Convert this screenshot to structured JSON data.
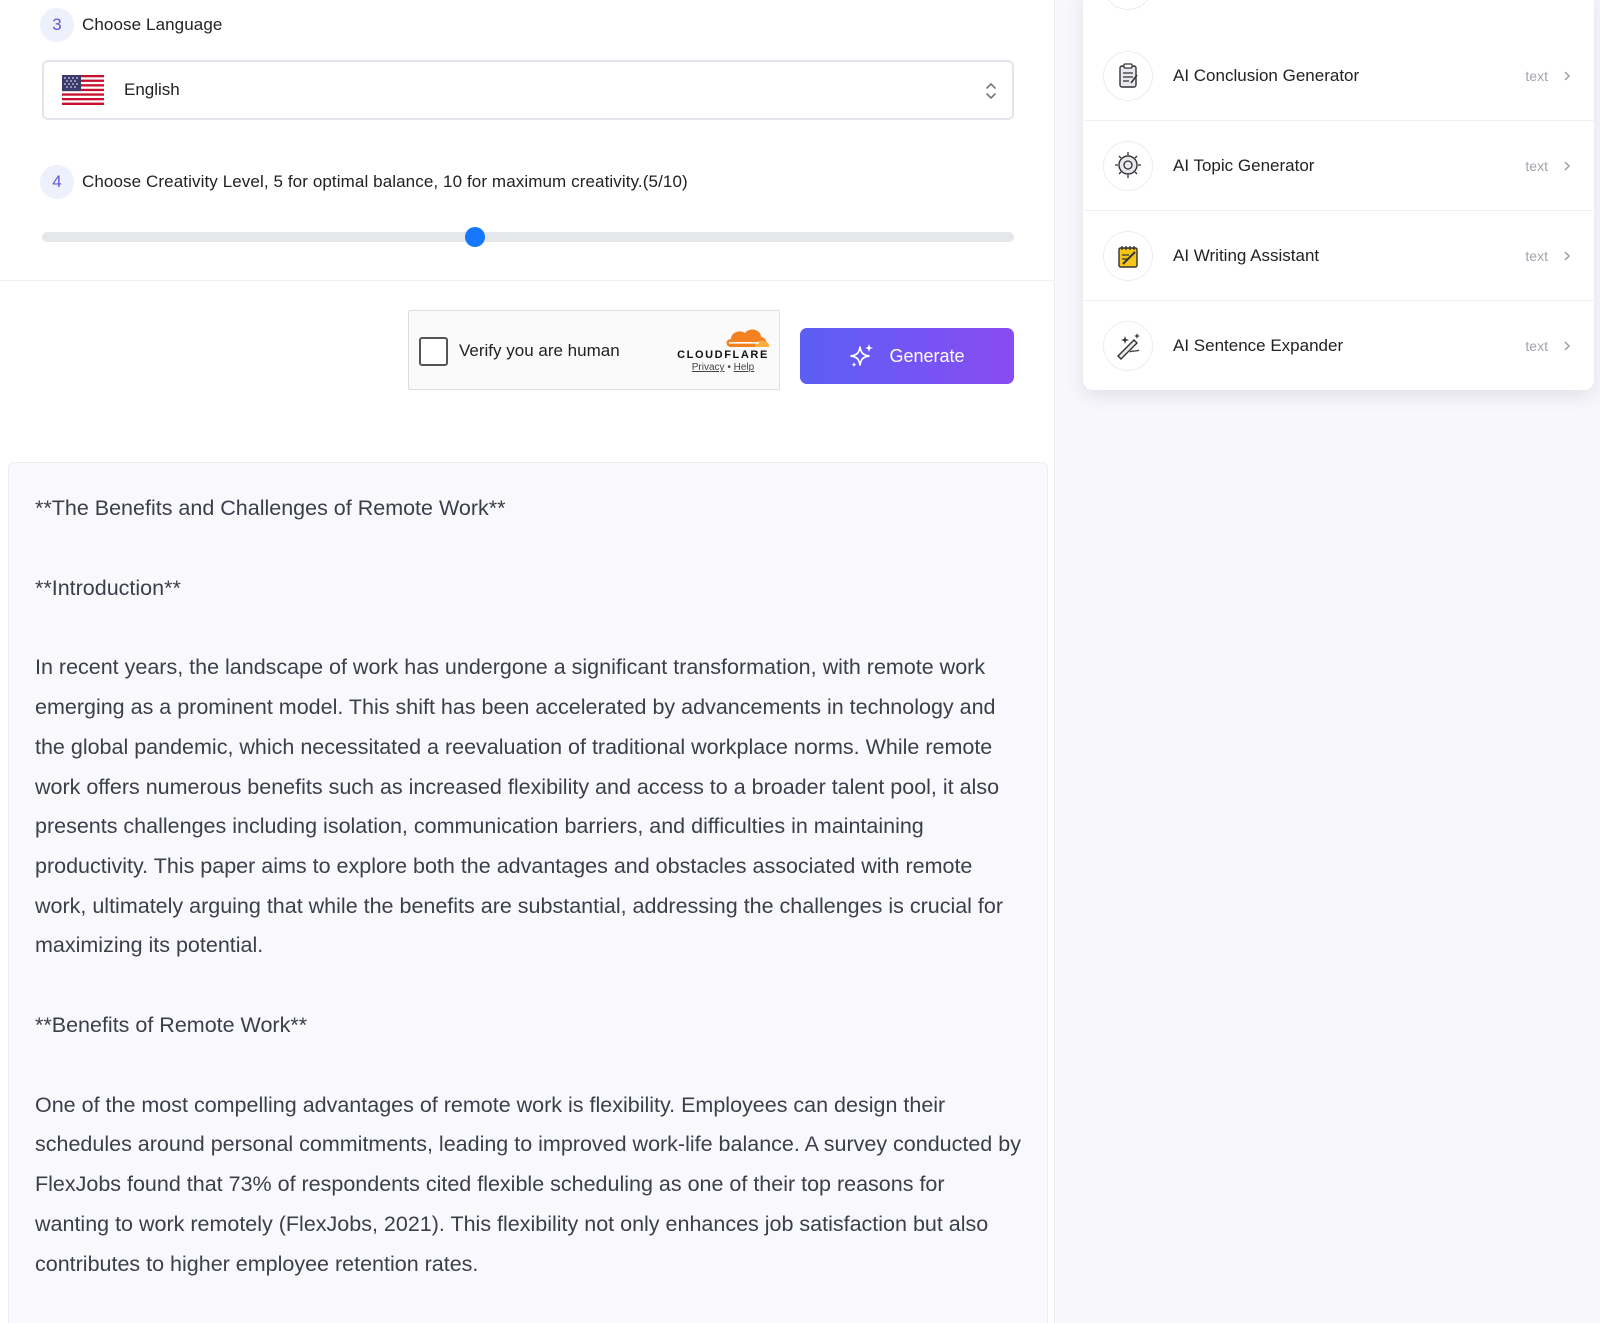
{
  "steps": {
    "language": {
      "number": "3",
      "label": "Choose Language",
      "selected": "English"
    },
    "creativity": {
      "number": "4",
      "label": "Choose Creativity Level, 5 for optimal balance, 10 for maximum creativity.(5/10)",
      "level": 5,
      "max": 10,
      "fill_fraction": 0.445
    }
  },
  "captcha": {
    "label": "Verify you are human",
    "brand": "CLOUDFLARE",
    "privacy": "Privacy",
    "separator": "•",
    "help": "Help"
  },
  "generate_button": {
    "label": "Generate",
    "color_start": "#5b5ef4",
    "color_end": "#8a4cf2"
  },
  "output": {
    "paragraphs": [
      "**The Benefits and Challenges of Remote Work**",
      "**Introduction**",
      "In recent years, the landscape of work has undergone a significant transformation, with remote work emerging as a prominent model. This shift has been accelerated by advancements in technology and the global pandemic, which necessitated a reevaluation of traditional workplace norms. While remote work offers numerous benefits such as increased flexibility and access to a broader talent pool, it also presents challenges including isolation, communication barriers, and difficulties in maintaining productivity. This paper aims to explore both the advantages and obstacles associated with remote work, ultimately arguing that while the benefits are substantial, addressing the challenges is crucial for maximizing its potential.",
      "**Benefits of Remote Work**",
      "One of the most compelling advantages of remote work is flexibility. Employees can design their schedules around personal commitments, leading to improved work-life balance. A survey conducted by FlexJobs found that 73% of respondents cited flexible scheduling as one of their top reasons for wanting to work remotely (FlexJobs, 2021). This flexibility not only enhances job satisfaction but also contributes to higher employee retention rates."
    ]
  },
  "sidebar": {
    "items": [
      {
        "label": "AI Conclusion Generator",
        "tag": "text",
        "icon": "clipboard-icon"
      },
      {
        "label": "AI Topic Generator",
        "tag": "text",
        "icon": "lightbulb-icon"
      },
      {
        "label": "AI Writing Assistant",
        "tag": "text",
        "icon": "notepad-icon"
      },
      {
        "label": "AI Sentence Expander",
        "tag": "text",
        "icon": "magic-pen-icon"
      }
    ]
  },
  "colors": {
    "accent": "#5b5bd6",
    "slider_thumb": "#1677ff",
    "text_body": "#3b3f4a"
  }
}
